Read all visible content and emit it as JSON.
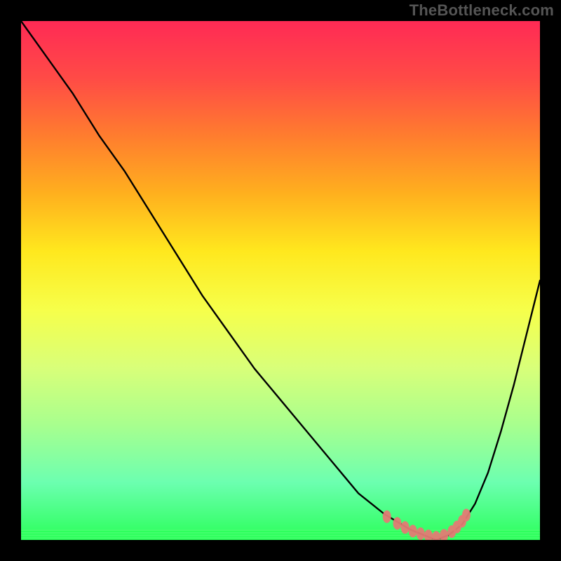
{
  "watermark": "TheBottleneck.com",
  "colors": {
    "frame": "#000000",
    "curve": "#000000",
    "marker": "#e37b74",
    "greenBand": "#2bff5a",
    "gradientStops": [
      "#ff2a55",
      "#ff4b46",
      "#ff7d2e",
      "#ffb01e",
      "#ffe81e",
      "#f6ff4a",
      "#d9ff79",
      "#a8ff8e",
      "#6cffb0",
      "#2bff5a"
    ]
  },
  "chart_data": {
    "type": "line",
    "title": "",
    "xlabel": "",
    "ylabel": "",
    "xlim": [
      0,
      100
    ],
    "ylim": [
      0,
      100
    ],
    "x": [
      0,
      5,
      10,
      15,
      20,
      25,
      30,
      35,
      40,
      45,
      50,
      55,
      60,
      62.5,
      65,
      67.5,
      70,
      72.5,
      75,
      77.5,
      80,
      82.5,
      85,
      87.5,
      90,
      92.5,
      95,
      97.5,
      100
    ],
    "y": [
      100,
      93,
      86,
      78,
      71,
      63,
      55,
      47,
      40,
      33,
      27,
      21,
      15,
      12,
      9,
      7,
      5,
      3.5,
      2,
      1,
      0,
      1,
      3,
      7,
      13,
      21,
      30,
      40,
      50
    ],
    "optimalBandY": [
      0,
      2
    ],
    "markers": [
      {
        "x": 70.5,
        "y": 4.5
      },
      {
        "x": 72.5,
        "y": 3.2
      },
      {
        "x": 74.0,
        "y": 2.4
      },
      {
        "x": 75.5,
        "y": 1.7
      },
      {
        "x": 77.0,
        "y": 1.2
      },
      {
        "x": 78.5,
        "y": 0.8
      },
      {
        "x": 80.0,
        "y": 0.5
      },
      {
        "x": 81.5,
        "y": 0.9
      },
      {
        "x": 83.0,
        "y": 1.6
      },
      {
        "x": 84.0,
        "y": 2.5
      },
      {
        "x": 85.0,
        "y": 3.6
      },
      {
        "x": 85.8,
        "y": 4.8
      }
    ]
  }
}
